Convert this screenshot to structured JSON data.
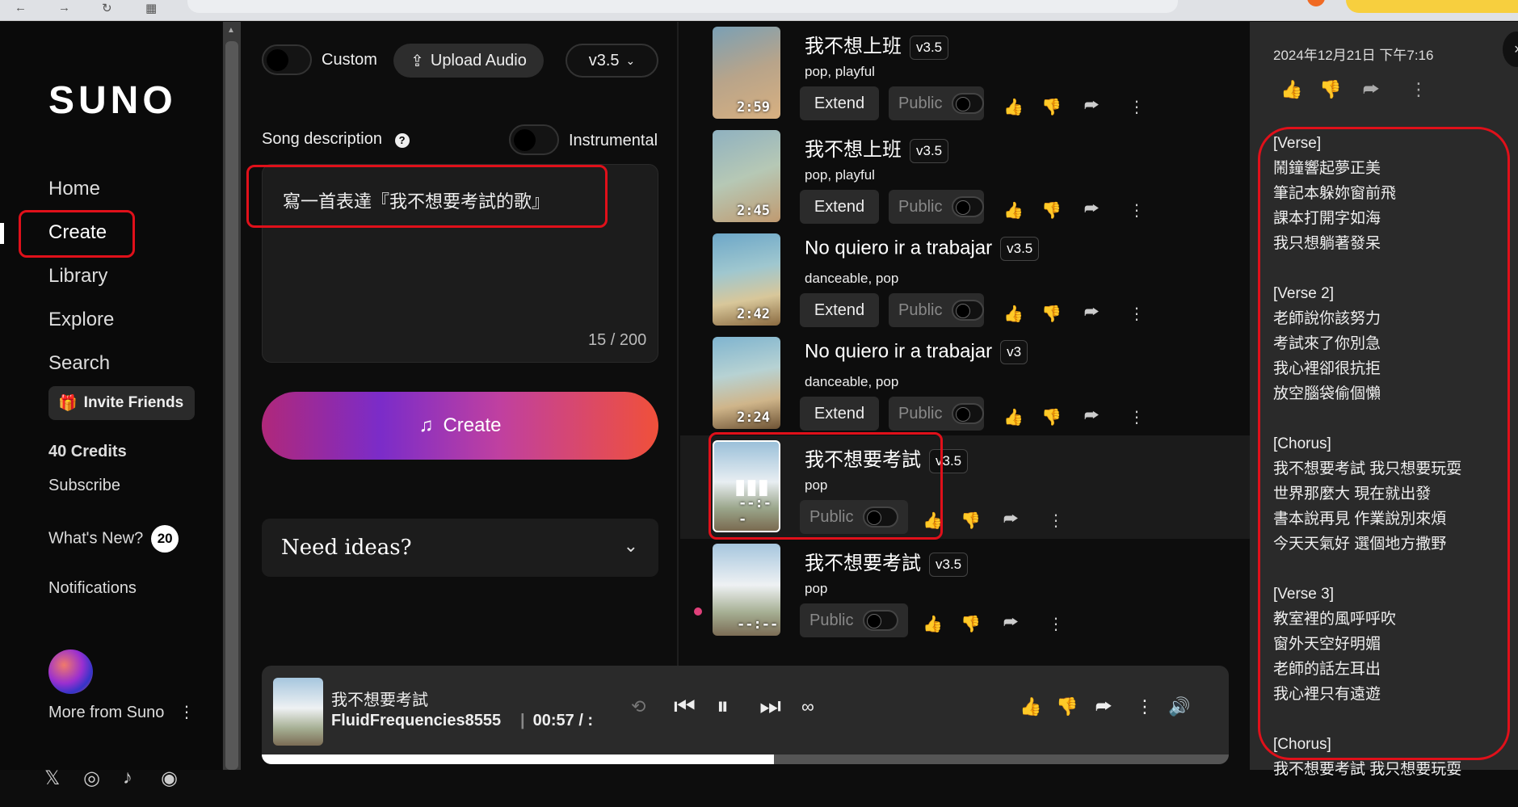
{
  "sidebar": {
    "logo": "SUNO",
    "nav": [
      "Home",
      "Create",
      "Library",
      "Explore",
      "Search"
    ],
    "invite_label": "Invite Friends",
    "credits": "40 Credits",
    "subscribe": "Subscribe",
    "whats_new": "What's New?",
    "whats_new_count": "20",
    "notifications": "Notifications",
    "more_from": "More from Suno",
    "social": [
      "𝕏",
      "◎",
      "♪",
      "◉"
    ]
  },
  "create_panel": {
    "custom_label": "Custom",
    "upload_label": "Upload Audio",
    "version": "v3.5",
    "description_label": "Song description",
    "instrumental_label": "Instrumental",
    "description_value": "寫一首表達『我不想要考試的歌』",
    "counter": "15 / 200",
    "create_label": "Create",
    "ideas_label": "Need ideas?"
  },
  "songs": [
    {
      "title": "我不想上班",
      "version": "v3.5",
      "tags": "pop, playful",
      "duration": "2:59",
      "extend": "Extend",
      "public": "Public"
    },
    {
      "title": "我不想上班",
      "version": "v3.5",
      "tags": "pop, playful",
      "duration": "2:45",
      "extend": "Extend",
      "public": "Public"
    },
    {
      "title": "No quiero ir a trabajar",
      "version": "v3.5",
      "tags": "danceable, pop",
      "duration": "2:42",
      "extend": "Extend",
      "public": "Public"
    },
    {
      "title": "No quiero ir a trabajar",
      "version": "v3",
      "tags": "danceable, pop",
      "duration": "2:24",
      "extend": "Extend",
      "public": "Public"
    },
    {
      "title": "我不想要考試",
      "version": "v3.5",
      "tags": "pop",
      "duration": "--:--",
      "public": "Public"
    },
    {
      "title": "我不想要考試",
      "version": "v3.5",
      "tags": "pop",
      "duration": "--:--",
      "public": "Public"
    }
  ],
  "player": {
    "title": "我不想要考試",
    "artist": "FluidFrequencies8555",
    "time": "00:57 / :",
    "progress": 0.53
  },
  "right_panel": {
    "datetime": "2024年12月21日 下午7:16",
    "lyrics": [
      {
        "label": "[Verse]",
        "lines": [
          "鬧鐘響起夢正美",
          "筆記本躲妳窗前飛",
          "課本打開字如海",
          "我只想躺著發呆"
        ]
      },
      {
        "label": "[Verse 2]",
        "lines": [
          "老師說你該努力",
          "考試來了你別急",
          "我心裡卻很抗拒",
          "放空腦袋偷個懶"
        ]
      },
      {
        "label": "[Chorus]",
        "lines": [
          "我不想要考試 我只想要玩耍",
          "世界那麼大 現在就出發",
          "書本說再見 作業說別來煩",
          "今天天氣好 選個地方撒野"
        ]
      },
      {
        "label": "[Verse 3]",
        "lines": [
          "教室裡的風呼呼吹",
          "窗外天空好明媚",
          "老師的話左耳出",
          "我心裡只有遠遊"
        ]
      },
      {
        "label": "[Chorus]",
        "lines": [
          "我不想要考試 我只想要玩耍"
        ]
      }
    ]
  },
  "colors": {
    "accent_red": "#e0101a",
    "bg": "#0d0d0d",
    "panel": "#2a2a2a"
  }
}
